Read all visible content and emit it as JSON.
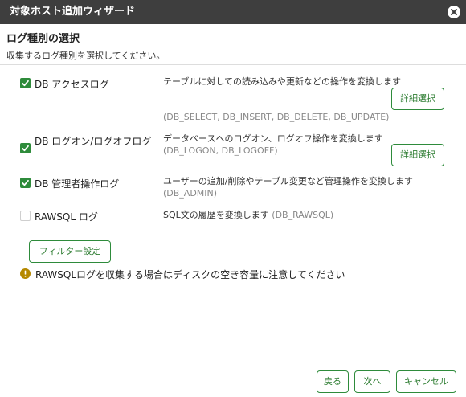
{
  "window": {
    "title": "対象ホスト追加ウィザード"
  },
  "section": {
    "title": "ログ種別の選択",
    "description": "収集するログ種別を選択してください。"
  },
  "options": [
    {
      "label": "DB アクセスログ",
      "checked": true,
      "description": "テーブルに対しての読み込みや更新などの操作を変換します",
      "codes": "(DB_SELECT, DB_INSERT, DB_DELETE, DB_UPDATE)",
      "detail_button": "詳細選択"
    },
    {
      "label": "DB ログオン/ログオフログ",
      "checked": true,
      "description": "データベースへのログオン、ログオフ操作を変換します",
      "codes": "(DB_LOGON, DB_LOGOFF)",
      "detail_button": "詳細選択"
    },
    {
      "label": "DB 管理者操作ログ",
      "checked": true,
      "description": "ユーザーの追加/削除やテーブル変更など管理操作を変換します",
      "codes": "(DB_ADMIN)"
    },
    {
      "label": "RAWSQL ログ",
      "checked": false,
      "description": "SQL文の履歴を変換します",
      "codes": "(DB_RAWSQL)"
    }
  ],
  "filter_button": "フィルター設定",
  "warning": "RAWSQLログを収集する場合はディスクの空き容量に注意してください",
  "footer": {
    "back": "戻る",
    "next": "次へ",
    "cancel": "キャンセル"
  },
  "colors": {
    "titlebar": "#3e3e3e",
    "accent": "#2e8b3b",
    "warning": "#b58900"
  }
}
